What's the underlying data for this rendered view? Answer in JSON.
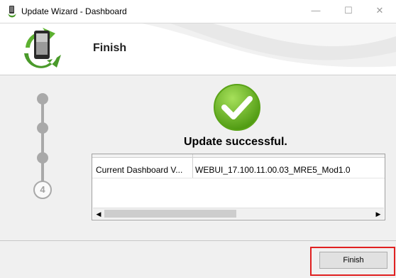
{
  "window": {
    "title": "Update Wizard - Dashboard",
    "minimize": "—",
    "maximize": "☐",
    "close": "✕"
  },
  "header": {
    "title": "Finish"
  },
  "steps": {
    "current": "4"
  },
  "status": {
    "message": "Update successful."
  },
  "table": {
    "rows": [
      {
        "name": "Current Dashboard V...",
        "value": "WEBUI_17.100.11.00.03_MRE5_Mod1.0"
      }
    ]
  },
  "scrollbar": {
    "left": "◀",
    "right": "▶"
  },
  "footer": {
    "finish_label": "Finish"
  },
  "colors": {
    "success": "#6dbb1e",
    "highlight": "#e02020"
  }
}
